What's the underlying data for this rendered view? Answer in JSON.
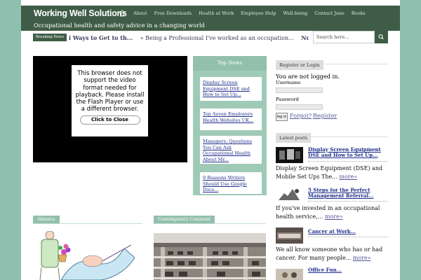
{
  "site": {
    "logo": "Working Well Solutions",
    "tagline": "Occupational health and safety advice in a changing world"
  },
  "nav": {
    "items": [
      "About",
      "Free Downloads",
      "Health at Work",
      "Employee Help",
      "Well-being",
      "Contact Jane",
      "Books"
    ]
  },
  "ticker": {
    "badge": "Breaking News",
    "items": [
      "i Ways to Get to th...",
      "» Being a Professional I've worked as an occupation...",
      "Nurse"
    ]
  },
  "search": {
    "placeholder": "Search here..."
  },
  "video": {
    "message": "This browser does not support the video format needed for playback. Please install the Flash Player or use a different browser.",
    "close_label": "Click to Close"
  },
  "top_news": {
    "title": "Top News",
    "items": [
      "Display Screen Equipment DSE and How to Set Up...",
      "Top Seven Employers Health Websites UK...",
      "Managers: Questions You Can Ask Occupational Health About Mr...",
      "9 Reasons Writers Should Use Google Docs..."
    ]
  },
  "login": {
    "heading": "Register or Login",
    "status": "You are not logged in.",
    "username_label": "Username",
    "password_label": "Password",
    "login_button": "log in",
    "forgot_link": "Forgot?",
    "register_link": "Register"
  },
  "latest": {
    "heading": "Latest posts",
    "more_label": "more»",
    "posts": [
      {
        "title": "Display Screen Equipment DSE and How to Set Up...",
        "excerpt": "Display Screen Equipment (DSE) and Mobile Set Ups The..."
      },
      {
        "title": "5 Steps for the Perfect Management Referral...",
        "excerpt": "If you've invested in an occupational health service,..."
      },
      {
        "title": "Cancer at Work...",
        "excerpt": "We all know someone who has or had cancer. For many people..."
      },
      {
        "title": "Office Fun...",
        "excerpt": ""
      }
    ]
  },
  "sections": {
    "absence": "Absence",
    "comment": "Contemporary Comment"
  }
}
